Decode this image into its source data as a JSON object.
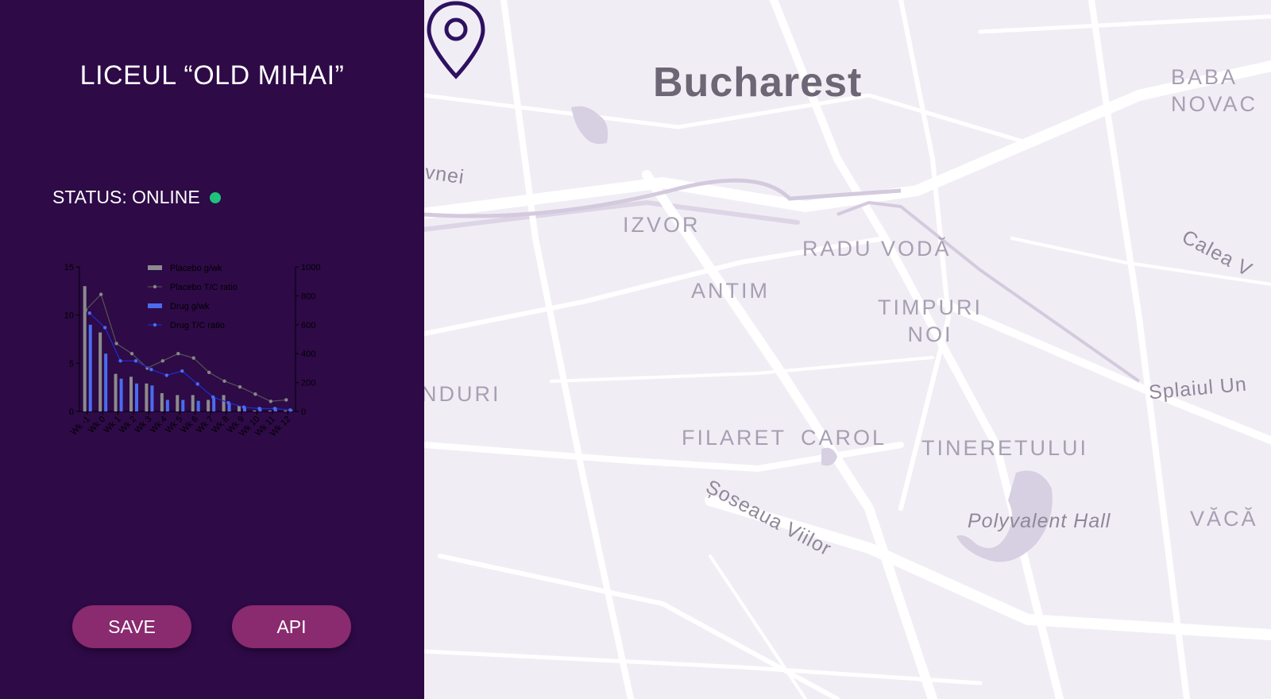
{
  "sidebar": {
    "title": "LICEUL “OLD MIHAI”",
    "status_text": "STATUS: ONLINE",
    "status_color": "#1fc27b",
    "background_color": "#2e0a47",
    "buttons": {
      "save": "SAVE",
      "api": "API",
      "color": "#8a2a6f"
    }
  },
  "chart_data": {
    "type": "bar",
    "categories": [
      "Wk -1",
      "Wk 0",
      "Wk 1",
      "Wk 2",
      "Wk 3",
      "Wk 4",
      "Wk 5",
      "Wk 6",
      "Wk 7",
      "Wk 8",
      "Wk 9",
      "Wk 10",
      "Wk 11",
      "Wk 12"
    ],
    "series": [
      {
        "name": "Placebo g/wk",
        "type": "bar",
        "axis": "left",
        "color": "#8c8c8c",
        "values": [
          13,
          8.2,
          3.9,
          3.6,
          2.9,
          1.9,
          1.7,
          1.7,
          1.2,
          1.7,
          0.6,
          0.1,
          0.1,
          0.1
        ]
      },
      {
        "name": "Placebo T/C ratio",
        "type": "line",
        "axis": "right",
        "color": "#555555",
        "values": [
          700,
          810,
          470,
          400,
          300,
          350,
          400,
          370,
          270,
          210,
          170,
          120,
          70,
          80
        ]
      },
      {
        "name": "Drug g/wk",
        "type": "bar",
        "axis": "left",
        "color": "#4b6cf0",
        "values": [
          9,
          6,
          3.4,
          2.9,
          2.7,
          1.2,
          1.2,
          1.1,
          1.5,
          0.9,
          0.5,
          0.4,
          0.4,
          0.2
        ]
      },
      {
        "name": "Drug T/C ratio",
        "type": "line",
        "axis": "right",
        "color": "#1a2fd6",
        "values": [
          680,
          580,
          350,
          350,
          290,
          250,
          280,
          190,
          100,
          60,
          30,
          20,
          20,
          10
        ]
      }
    ],
    "ylim_left": [
      0,
      15
    ],
    "yticks_left": [
      0,
      5,
      10,
      15
    ],
    "ylim_right": [
      0,
      1000
    ],
    "yticks_right": [
      0,
      200,
      400,
      600,
      800,
      1000
    ],
    "legend": "top-center"
  },
  "map": {
    "city": "Bucharest",
    "labels": {
      "baba_novaci": "BABA NOVAC",
      "izvor": "IZVOR",
      "radu_voda": "RADU VODĂ",
      "antim": "ANTIM",
      "timpuri_noi": "TIMPURI NOI",
      "nduri": "NDURI",
      "filaret": "FILARET",
      "carol": "CAROL",
      "tineretului": "TINERETULUI",
      "vaca": "VĂCĂ",
      "evnei": "evnei",
      "calea": "Calea V",
      "splaiul": "Splaiul Un",
      "soseaua_viilor": "Șoseaua Viilor",
      "polyvalent_hall": "Polyvalent Hall"
    },
    "pin_color": "#2e1160",
    "pin_icon": "map-pin-icon"
  }
}
